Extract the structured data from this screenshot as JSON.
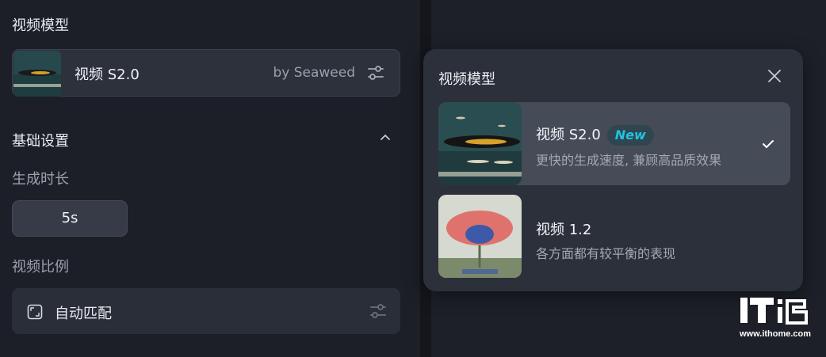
{
  "left": {
    "section_title": "视频模型",
    "model_card": {
      "name": "视频 S2.0",
      "byline": "by Seaweed",
      "thumb_icon": "whale-thumbnail"
    },
    "basic_settings": "基础设置",
    "duration_label": "生成时长",
    "duration_value": "5s",
    "ratio_label": "视频比例",
    "ratio_value": "自动匹配"
  },
  "popup": {
    "title": "视频模型",
    "options": [
      {
        "name": "视频 S2.0",
        "badge": "New",
        "desc": "更快的生成速度, 兼顾高品质效果",
        "selected": true
      },
      {
        "name": "视频 1.2",
        "badge": "",
        "desc": "各方面都有较平衡的表现",
        "selected": false
      }
    ]
  },
  "watermark": {
    "url": "www.ithome.com"
  },
  "colors": {
    "accent": "#22c3df",
    "selected_bg": "#464b58",
    "card_bg": "#2c313c"
  }
}
